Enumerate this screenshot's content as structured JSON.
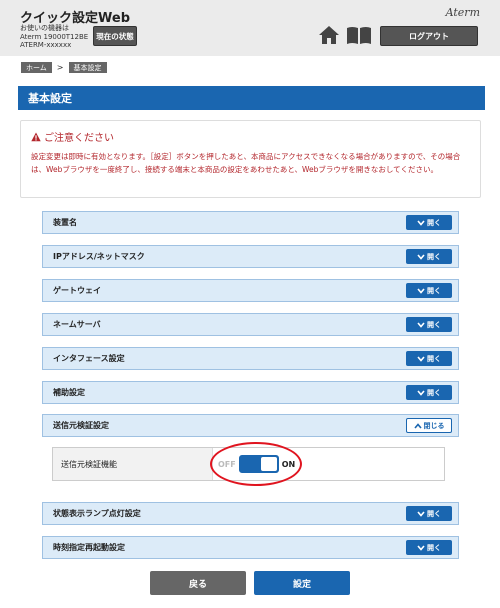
{
  "header": {
    "title": "クイック設定Web",
    "device_lines": [
      "お使いの機器は",
      "Aterm 19000T12BE",
      "ATERM-xxxxxx"
    ],
    "status_button": "現在の状態",
    "brand": "Aterm",
    "logout_button": "ログアウト",
    "icons": [
      "home-icon",
      "book-icon"
    ]
  },
  "breadcrumb": {
    "items": [
      "ホーム",
      "基本設定"
    ],
    "separator": ">"
  },
  "section": {
    "title": "基本設定"
  },
  "caution": {
    "title": "ご注意ください",
    "text": "設定変更は即時に有効となります。［設定］ボタンを押したあと、本商品にアクセスできなくなる場合がありますので、その場合は、Webブラウザを一度終了し、接続する端末と本商品の設定をあわせたあと、Webブラウザを開きなおしてください。"
  },
  "accordion": {
    "open_label": "開く",
    "close_label": "閉じる",
    "rows": [
      {
        "label": "装置名",
        "state": "closed"
      },
      {
        "label": "IPアドレス/ネットマスク",
        "state": "closed"
      },
      {
        "label": "ゲートウェイ",
        "state": "closed"
      },
      {
        "label": "ネームサーバ",
        "state": "closed"
      },
      {
        "label": "インタフェース設定",
        "state": "closed"
      },
      {
        "label": "補助設定",
        "state": "closed"
      },
      {
        "label": "送信元検証設定",
        "state": "open"
      },
      {
        "label": "状態表示ランプ点灯設定",
        "state": "closed"
      },
      {
        "label": "時刻指定再起動設定",
        "state": "closed"
      }
    ]
  },
  "source_verification": {
    "label": "送信元検証機能",
    "off_text": "OFF",
    "on_text": "ON",
    "value": "ON"
  },
  "buttons": {
    "back": "戻る",
    "submit": "設定"
  },
  "colors": {
    "primary": "#1a66b0",
    "row_bg": "#dcebf8",
    "warning": "#b3262c",
    "highlight": "#e0141f",
    "dark_button": "#555555"
  }
}
